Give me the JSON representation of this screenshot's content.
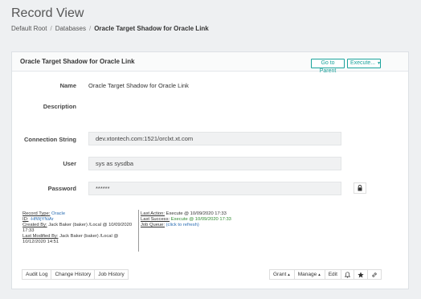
{
  "page": {
    "title": "Record View"
  },
  "breadcrumb": {
    "items": [
      "Default Root",
      "Databases"
    ],
    "current": "Oracle Target Shadow for Oracle Link",
    "separator": "/"
  },
  "panel": {
    "title": "Oracle Target Shadow for Oracle Link",
    "go_to_parent": "Go to Parent",
    "execute": "Execute..."
  },
  "fields": {
    "name_label": "Name",
    "name_value": "Oracle Target Shadow for Oracle Link",
    "description_label": "Description",
    "connection_label": "Connection String",
    "connection_value": "dev.xtontech.com:1521/orclxt.xt.com",
    "user_label": "User",
    "user_value": "sys as sysdba",
    "password_label": "Password",
    "password_value": "******"
  },
  "meta": {
    "record_type_key": "Record Type:",
    "record_type_val": "Oracle",
    "id_key": "ID:",
    "id_val": "-HfWjYNiAr",
    "created_key": "Created By:",
    "created_val": "Jack Baker (baker) /Local @ 10/09/2020 17:33",
    "modified_key": "Last Modified By:",
    "modified_val": "Jack Baker (baker) /Local @ 10/12/2020 14:51",
    "last_action_key": "Last Action:",
    "last_action_val": "Execute @ 10/09/2020 17:33",
    "last_success_key": "Last Success:",
    "last_success_val": "Execute @ 10/09/2020 17:33",
    "job_queue_key": "Job Queue:",
    "job_queue_val": "(click to refresh)"
  },
  "footer_left": {
    "audit_log": "Audit Log",
    "change_history": "Change History",
    "job_history": "Job History"
  },
  "footer_right": {
    "grant": "Grant",
    "manage": "Manage",
    "edit": "Edit"
  },
  "icons": {
    "lock": "lock-icon",
    "bell": "bell-icon",
    "star": "star-icon",
    "link": "link-icon"
  },
  "colors": {
    "accent": "#1ba39c",
    "link": "#2a6db3",
    "success": "#2e8b2e"
  }
}
